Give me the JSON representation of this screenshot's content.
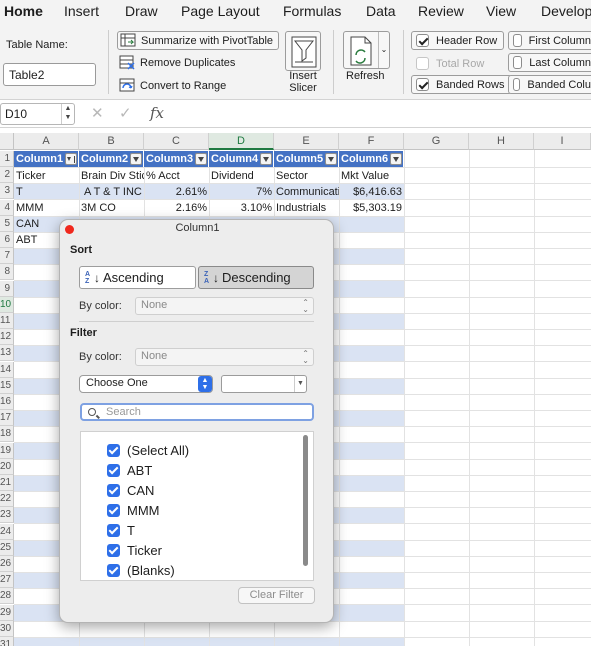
{
  "ribbon_tabs": [
    "Home",
    "Insert",
    "Draw",
    "Page Layout",
    "Formulas",
    "Data",
    "Review",
    "View",
    "Develop"
  ],
  "ribbon": {
    "table_name_label": "Table Name:",
    "table_name_value": "Table2",
    "summarize": "Summarize with PivotTable",
    "remove_duplicates": "Remove Duplicates",
    "convert_to_range": "Convert to Range",
    "insert_slicer": "Insert\nSlicer",
    "insert_slicer_l1": "Insert",
    "insert_slicer_l2": "Slicer",
    "refresh": "Refresh",
    "header_row": "Header Row",
    "total_row": "Total Row",
    "banded_rows": "Banded Rows",
    "first_column": "First Column",
    "last_column": "Last Column",
    "banded_columns": "Banded Colu"
  },
  "formula_bar": {
    "name_box": "D10",
    "fx": "fx",
    "cancel_icon": "✕",
    "enter_icon": "✓"
  },
  "columns": [
    "A",
    "B",
    "C",
    "D",
    "E",
    "F",
    "G",
    "H",
    "I"
  ],
  "rows": [
    "1",
    "2",
    "3",
    "4",
    "5",
    "6",
    "7",
    "8",
    "9",
    "10",
    "11",
    "12",
    "13",
    "14",
    "15",
    "16",
    "17",
    "18",
    "19",
    "20",
    "21",
    "22",
    "23",
    "24",
    "25",
    "26",
    "27",
    "28",
    "29",
    "30",
    "31"
  ],
  "table": {
    "headers": [
      "Column1",
      "Column2",
      "Column3",
      "Column4",
      "Column5",
      "Column6"
    ],
    "row2": [
      "Ticker",
      "Brain Div Sticker",
      "% Acct",
      "Dividend",
      "Sector",
      "Mkt Value"
    ],
    "row3": [
      "T",
      "A T & T INC",
      "2.61%",
      "7%",
      "Communications",
      "$6,416.63"
    ],
    "row4": [
      "MMM",
      "3M CO",
      "2.16%",
      "3.10%",
      "Industrials",
      "$5,303.19"
    ],
    "row5": [
      "CAN"
    ],
    "row6": [
      "ABT"
    ]
  },
  "filter_popup": {
    "title": "Column1",
    "sort_label": "Sort",
    "ascending": "Ascending",
    "descending": "Descending",
    "by_color": "By color:",
    "none": "None",
    "filter_label": "Filter",
    "choose_one": "Choose One",
    "search_placeholder": "Search",
    "items": [
      "(Select All)",
      "ABT",
      "CAN",
      "MMM",
      "T",
      "Ticker",
      "(Blanks)"
    ],
    "clear_filter": "Clear Filter"
  },
  "colors": {
    "table_header": "#4472c4",
    "band": "#dae3f3",
    "accent_blue": "#2e6fe8",
    "selection_green": "#1f7a41"
  }
}
